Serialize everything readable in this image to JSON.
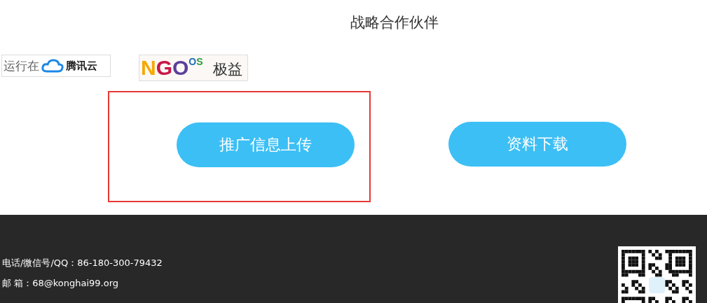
{
  "section_title": "战略合作伙伴",
  "partners": [
    {
      "kind": "cloud",
      "prefix": "运行在",
      "brand": "腾讯云"
    },
    {
      "kind": "ngo",
      "letters": [
        {
          "text": "N",
          "color": "#f5a800"
        },
        {
          "text": "G",
          "color": "#c8174a"
        },
        {
          "text": "O",
          "color": "#5b3f9a"
        }
      ],
      "superscript": [
        {
          "text": "O",
          "color": "#1f6fb8"
        },
        {
          "text": "S",
          "color": "#2a9a3c"
        }
      ],
      "name": "极益"
    }
  ],
  "buttons": [
    {
      "label": "推广信息上传",
      "highlighted": true
    },
    {
      "label": "资料下载",
      "highlighted": false
    }
  ],
  "footer": {
    "lines": [
      "电话/微信号/QQ：86-180-300-79432",
      "邮 箱：68@konghai99.org"
    ]
  }
}
